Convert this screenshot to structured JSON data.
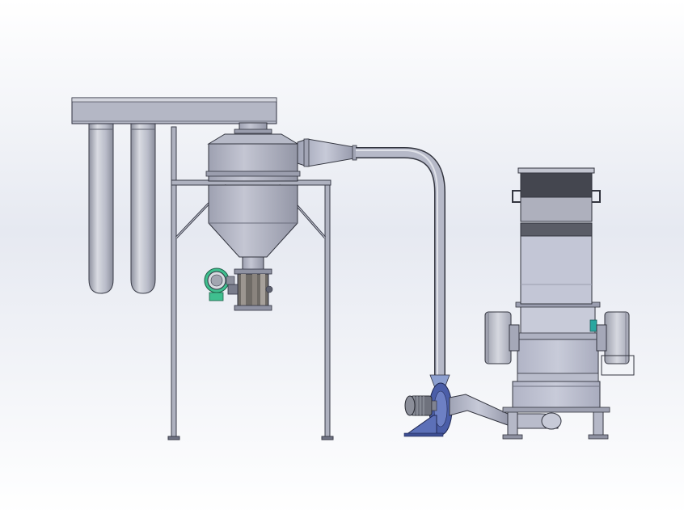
{
  "colors": {
    "bg_top": "#ffffff",
    "bg_mid": "#e9ecf3",
    "bg_bottom": "#ffffff",
    "steel_light": "#c9ccd6",
    "steel_mid": "#a9adbd",
    "steel_dark": "#5d6070",
    "outline": "#2f3140",
    "hopper_dark": "#44464f",
    "accent_green": "#3fbf8f",
    "accent_teal": "#2aa7a0",
    "blower_blue": "#4b5ea8"
  },
  "components": [
    "bag-filter-header",
    "filter-bag",
    "cyclone-separator",
    "support-frame",
    "rotary-valve",
    "valve-motor",
    "conveying-duct",
    "centrifugal-blower",
    "blower-motor",
    "crusher-hopper",
    "crusher-body",
    "crusher-flywheel",
    "crusher-base"
  ]
}
